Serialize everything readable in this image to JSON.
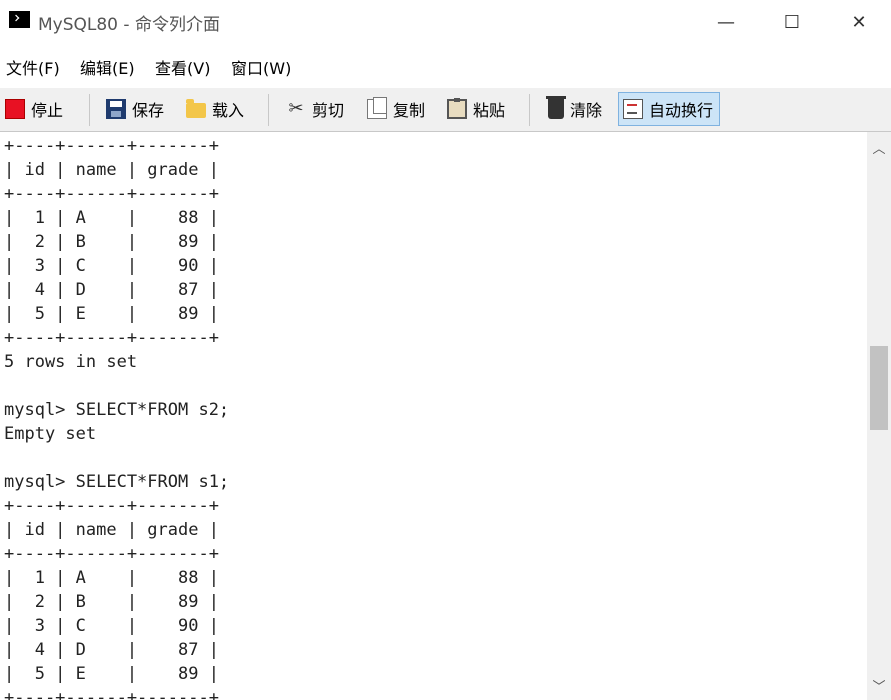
{
  "window": {
    "title": "MySQL80 - 命令列介面",
    "minimize_glyph": "—",
    "maximize_glyph": "☐",
    "close_glyph": "✕"
  },
  "menu": {
    "file": "文件(F)",
    "edit": "编辑(E)",
    "view": "查看(V)",
    "window": "窗口(W)"
  },
  "toolbar": {
    "stop": "停止",
    "save": "保存",
    "load": "载入",
    "cut": "剪切",
    "copy": "复制",
    "paste": "粘贴",
    "clear": "清除",
    "autowrap": "自动换行",
    "icons": {
      "stop": "stop-icon",
      "save": "floppy-disk-icon",
      "load": "folder-open-icon",
      "cut": "scissors-icon",
      "copy": "copy-icon",
      "paste": "clipboard-icon",
      "clear": "trash-can-icon",
      "autowrap": "word-wrap-icon"
    },
    "autowrap_active": true,
    "autowrap_color": "#cce4f7"
  },
  "console": {
    "lines": [
      "+----+------+-------+",
      "| id | name | grade |",
      "+----+------+-------+",
      "|  1 | A    |    88 |",
      "|  2 | B    |    89 |",
      "|  3 | C    |    90 |",
      "|  4 | D    |    87 |",
      "|  5 | E    |    89 |",
      "+----+------+-------+",
      "5 rows in set",
      "",
      "mysql> SELECT*FROM s2;",
      "Empty set",
      "",
      "mysql> SELECT*FROM s1;",
      "+----+------+-------+",
      "| id | name | grade |",
      "+----+------+-------+",
      "|  1 | A    |    88 |",
      "|  2 | B    |    89 |",
      "|  3 | C    |    90 |",
      "|  4 | D    |    87 |",
      "|  5 | E    |    89 |",
      "+----+------+-------+"
    ]
  },
  "scrollbar": {
    "up_glyph": "︿",
    "down_glyph": "﹀",
    "position_fraction": 0.42
  }
}
